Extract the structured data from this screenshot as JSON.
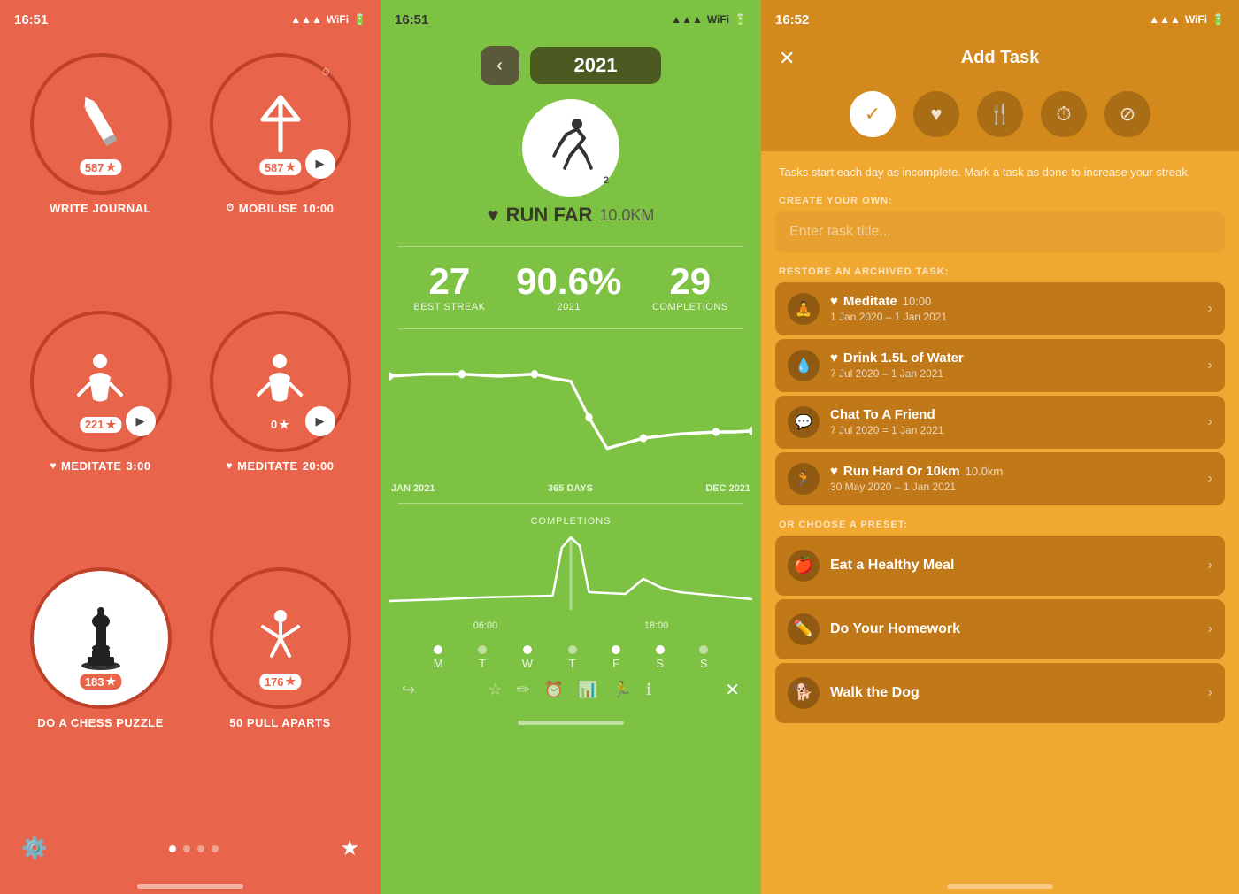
{
  "panel1": {
    "status_time": "16:51",
    "habits": [
      {
        "label": "WRITE JOURNAL",
        "streak": "587",
        "icon": "✏️",
        "type": "plain",
        "has_play": false,
        "has_clock": false,
        "has_heart": false,
        "time": ""
      },
      {
        "label": "MOBILISE",
        "streak": "587",
        "icon": "⚔️",
        "type": "plain",
        "has_play": true,
        "has_clock": true,
        "time": "10:00",
        "has_heart": false
      },
      {
        "label": "MEDITATE",
        "streak": "221",
        "icon": "🧘",
        "type": "plain",
        "has_play": true,
        "has_clock": false,
        "time": "3:00",
        "has_heart": true
      },
      {
        "label": "MEDITATE",
        "streak": "0",
        "icon": "🧘",
        "type": "plain",
        "has_play": true,
        "has_clock": false,
        "time": "20:00",
        "has_heart": true
      },
      {
        "label": "DO A CHESS PUZZLE",
        "streak": "183",
        "icon": "♟️",
        "type": "white",
        "has_play": false,
        "has_clock": false,
        "time": "",
        "has_heart": false
      },
      {
        "label": "50 PULL APARTS",
        "streak": "176",
        "icon": "🤸",
        "type": "plain",
        "has_play": false,
        "has_clock": false,
        "time": "",
        "has_heart": false
      }
    ],
    "settings_icon": "⚙️",
    "star_icon": "★"
  },
  "panel2": {
    "status_time": "16:51",
    "year": "2021",
    "habit_name": "RUN FAR",
    "habit_dist": "10.0KM",
    "best_streak": "27",
    "best_streak_label": "BEST STREAK",
    "pct_2021": "90.6%",
    "pct_label": "2021",
    "completions": "29",
    "completions_label": "COMPLETIONS",
    "chart_left": "JAN 2021",
    "chart_mid": "365 DAYS",
    "chart_right": "DEC 2021",
    "comp_title": "COMPLETIONS",
    "bar_left": "06:00",
    "bar_right": "18:00",
    "days": [
      "M",
      "T",
      "W",
      "T",
      "F",
      "S",
      "S"
    ],
    "active_days": [
      0,
      2,
      4
    ]
  },
  "panel3": {
    "status_time": "16:52",
    "title": "Add Task",
    "close_label": "✕",
    "description": "Tasks start each day as incomplete. Mark a task as done to increase your streak.",
    "create_label": "CREATE YOUR OWN:",
    "input_placeholder": "Enter task title...",
    "restore_label": "RESTORE AN ARCHIVED TASK:",
    "archived": [
      {
        "icon": "🧘",
        "title": "Meditate",
        "time": "10:00",
        "date": "1 Jan 2020 – 1 Jan 2021",
        "has_heart": true
      },
      {
        "icon": "💧",
        "title": "Drink 1.5L of Water",
        "time": "",
        "date": "7 Jul 2020 – 1 Jan 2021",
        "has_heart": true
      },
      {
        "icon": "💬",
        "title": "Chat To A Friend",
        "time": "",
        "date": "7 Jul 2020 – 1 Jan 2021",
        "has_heart": false
      },
      {
        "icon": "🏃",
        "title": "Run Hard Or 10km",
        "time": "10.0km",
        "date": "30 May 2020 – 1 Jan 2021",
        "has_heart": true
      }
    ],
    "preset_label": "OR CHOOSE A PRESET:",
    "presets": [
      {
        "icon": "🍎",
        "title": "Eat a Healthy Meal"
      },
      {
        "icon": "📚",
        "title": "Do Your Homework"
      },
      {
        "icon": "🐕",
        "title": "Walk the Dog"
      }
    ]
  }
}
